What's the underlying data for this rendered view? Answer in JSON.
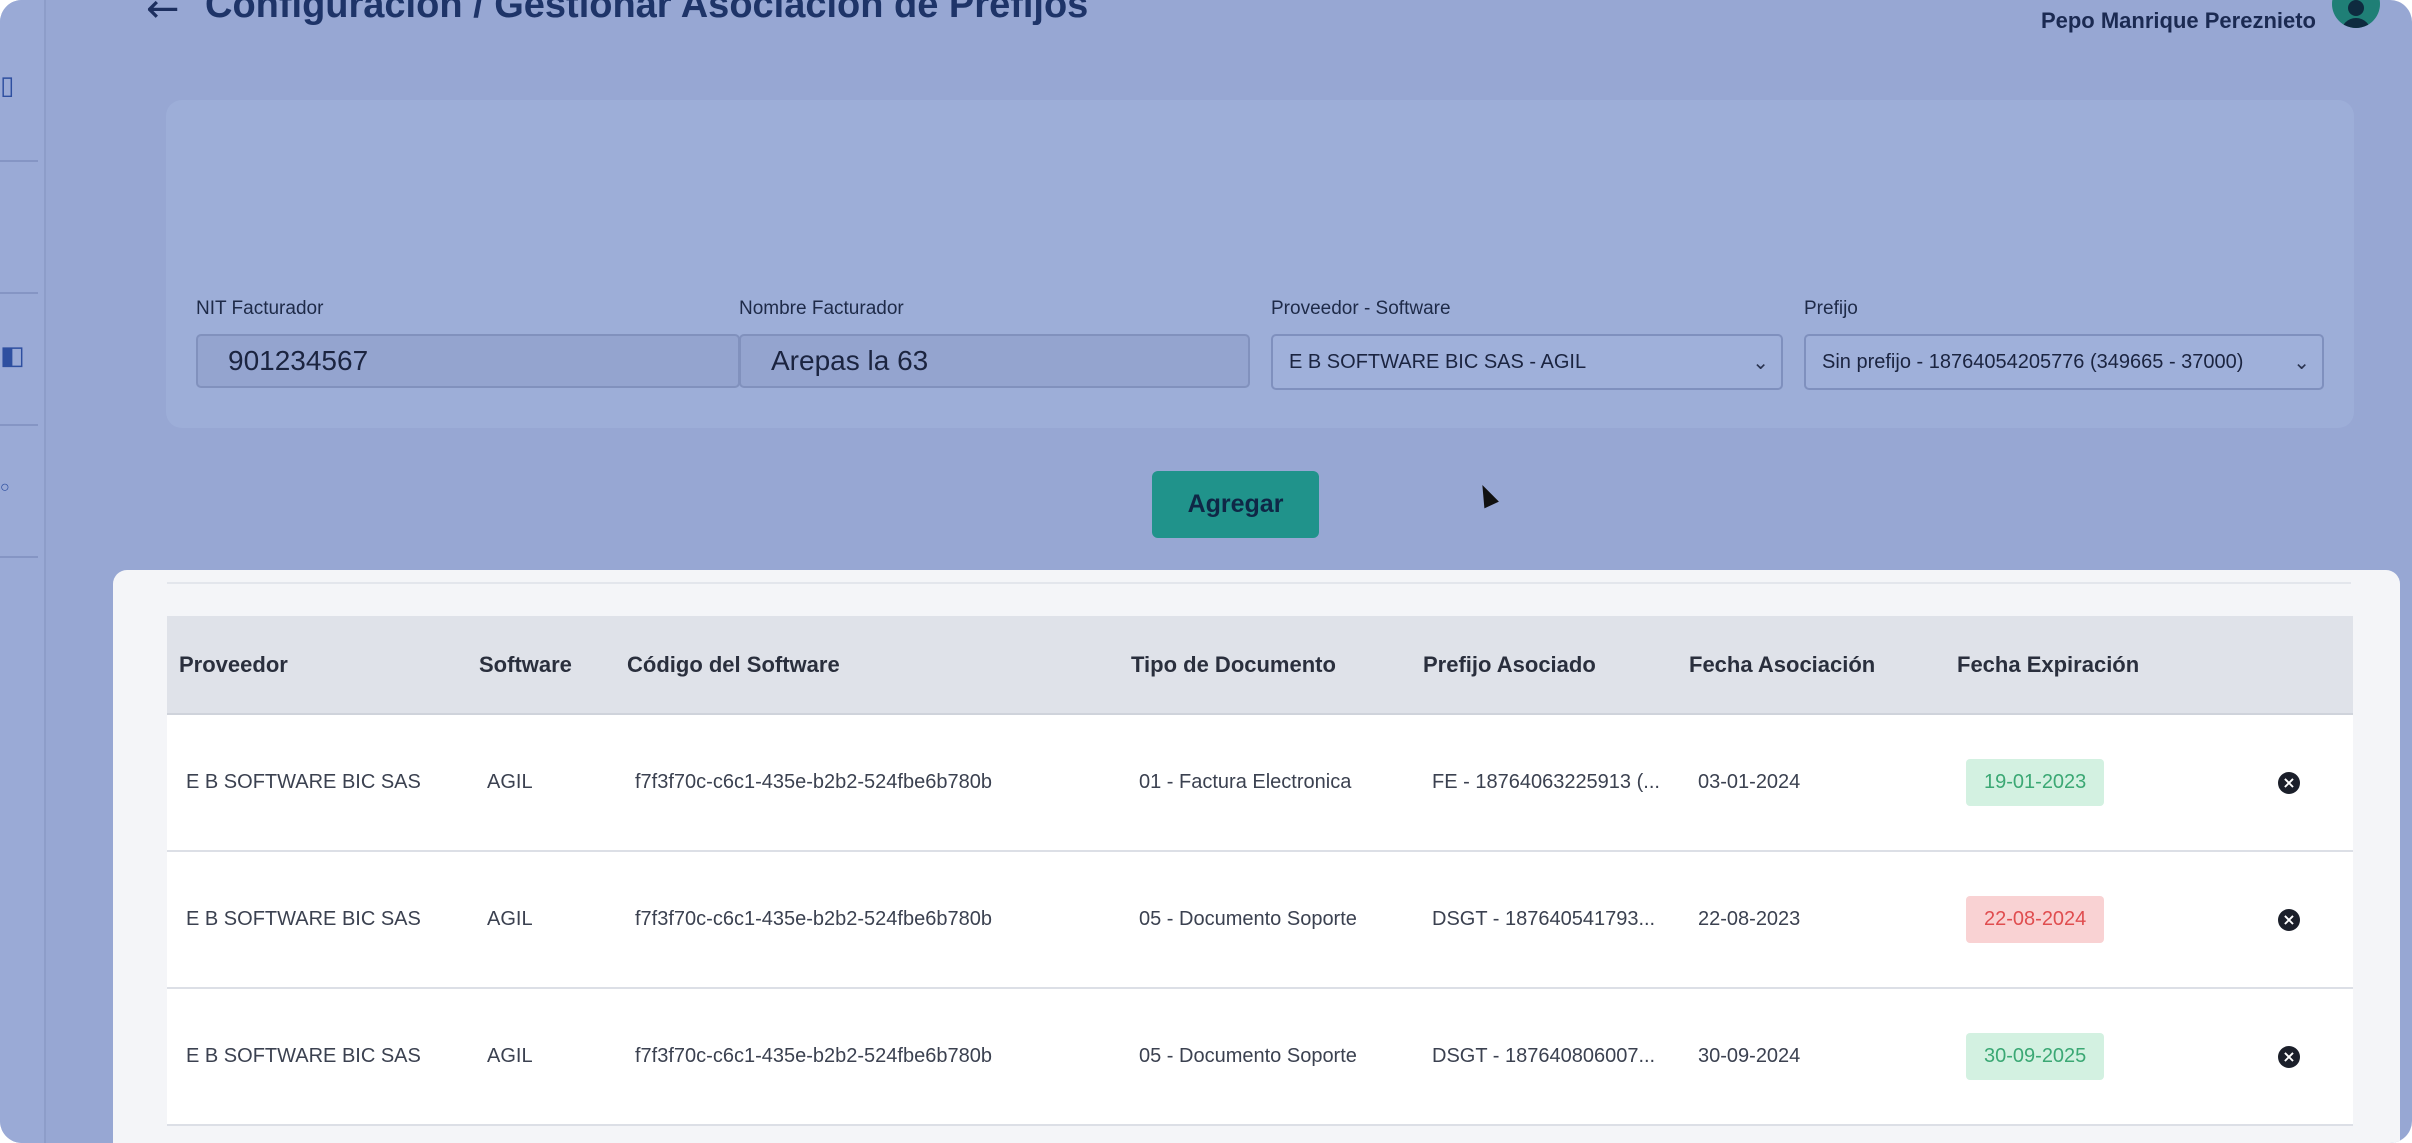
{
  "header": {
    "title": "Configuración / Gestionar Asociación de Prefijos",
    "user_name": "Pepo Manrique Pereznieto"
  },
  "sidebar": {
    "icons": [
      "document-icon",
      "chart-icon",
      "settings-icon"
    ]
  },
  "form": {
    "nit_label": "NIT Facturador",
    "nit_value": "901234567",
    "nombre_label": "Nombre Facturador",
    "nombre_value": "Arepas la 63",
    "proveedor_label": "Proveedor - Software",
    "proveedor_value": "E B SOFTWARE BIC SAS - AGIL",
    "prefijo_label": "Prefijo",
    "prefijo_value": "Sin prefijo - 18764054205776 (349665 - 37000)",
    "add_button": "Agregar"
  },
  "table": {
    "columns": [
      "Proveedor",
      "Software",
      "Código del Software",
      "Tipo de Documento",
      "Prefijo Asociado",
      "Fecha Asociación",
      "Fecha Expiración"
    ],
    "rows": [
      {
        "proveedor": "E B SOFTWARE BIC SAS",
        "software": "AGIL",
        "codigo": "f7f3f70c-c6c1-435e-b2b2-524fbe6b780b",
        "tipo": "01 - Factura Electronica",
        "prefijo": "FE - 18764063225913 (...",
        "fecha_asociacion": "03-01-2024",
        "fecha_expiracion": "19-01-2023",
        "expiracion_status": "green"
      },
      {
        "proveedor": "E B SOFTWARE BIC SAS",
        "software": "AGIL",
        "codigo": "f7f3f70c-c6c1-435e-b2b2-524fbe6b780b",
        "tipo": "05 - Documento Soporte",
        "prefijo": "DSGT - 187640541793...",
        "fecha_asociacion": "22-08-2023",
        "fecha_expiracion": "22-08-2024",
        "expiracion_status": "red"
      },
      {
        "proveedor": "E B SOFTWARE BIC SAS",
        "software": "AGIL",
        "codigo": "f7f3f70c-c6c1-435e-b2b2-524fbe6b780b",
        "tipo": "05 - Documento Soporte",
        "prefijo": "DSGT - 187640806007...",
        "fecha_asociacion": "30-09-2024",
        "fecha_expiracion": "30-09-2025",
        "expiracion_status": "green"
      }
    ]
  },
  "colors": {
    "accent": "#20938b",
    "badge_green_bg": "#d3f1e1",
    "badge_green_text": "#3ba874",
    "badge_red_bg": "#f9d2d3",
    "badge_red_text": "#e04d4f"
  }
}
